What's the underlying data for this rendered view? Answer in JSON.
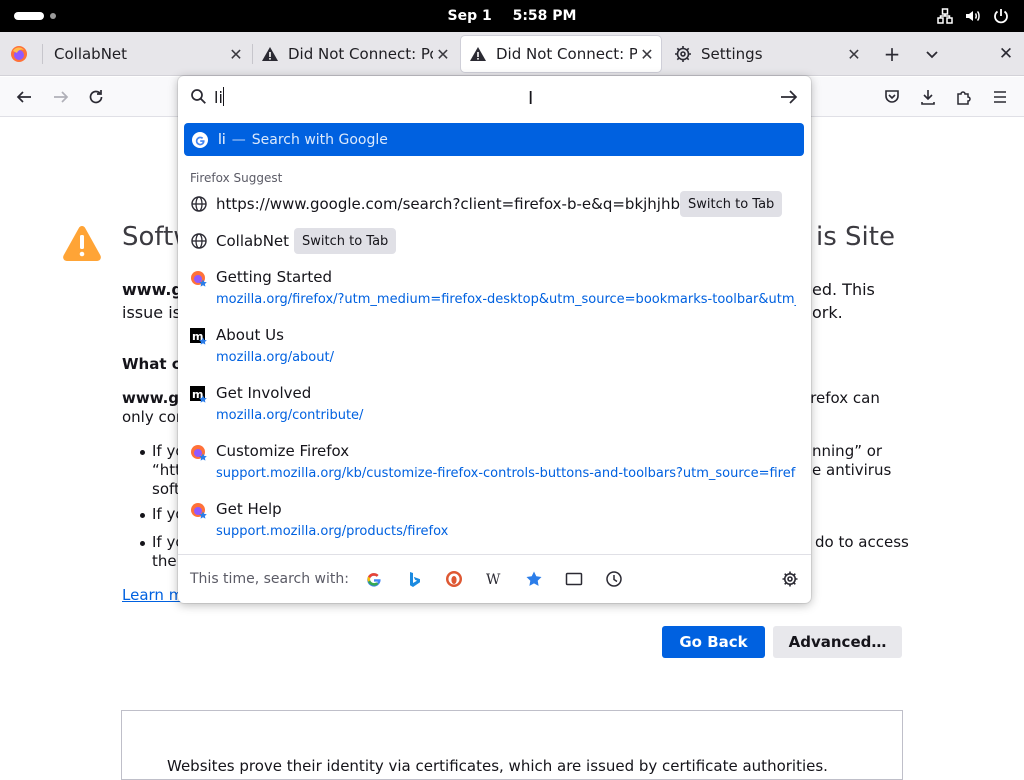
{
  "system": {
    "date": "Sep 1",
    "time": "5:58 PM"
  },
  "tabs": [
    {
      "label": "CollabNet",
      "icon": "firefox-icon",
      "selected": false
    },
    {
      "label": "Did Not Connect: Poter",
      "icon": "warning-icon",
      "selected": false
    },
    {
      "label": "Did Not Connect: Poter",
      "icon": "warning-icon",
      "selected": true
    },
    {
      "label": "Settings",
      "icon": "gear-icon",
      "selected": false
    }
  ],
  "urlbar": {
    "value": "li",
    "selected_suggestion": {
      "text": "li",
      "separator": "—",
      "action": "Search with Google"
    },
    "group_label": "Firefox Suggest",
    "switch_tab_label": "Switch to Tab",
    "results": [
      {
        "title": "https://www.google.com/search?client=firefox-b-e&q=bkjhjhbknkj",
        "icon": "globe-icon",
        "switch_to_tab": true
      },
      {
        "title": "CollabNet",
        "icon": "globe-icon",
        "switch_to_tab": true
      },
      {
        "title": "Getting Started",
        "url": "mozilla.org/firefox/?utm_medium=firefox-desktop&utm_source=bookmarks-toolbar&utm_campaign",
        "icon": "firefox-bookmark-icon"
      },
      {
        "title": "About Us",
        "url": "mozilla.org/about/",
        "icon": "mozilla-bookmark-icon"
      },
      {
        "title": "Get Involved",
        "url": "mozilla.org/contribute/",
        "icon": "mozilla-bookmark-icon"
      },
      {
        "title": "Customize Firefox",
        "url": "support.mozilla.org/kb/customize-firefox-controls-buttons-and-toolbars?utm_source=firefox-brow",
        "icon": "firefox-bookmark-icon"
      },
      {
        "title": "Get Help",
        "url": "support.mozilla.org/products/firefox",
        "icon": "firefox-bookmark-icon"
      }
    ],
    "footer_label": "This time, search with:",
    "engines": [
      "google-icon",
      "bing-icon",
      "duckduckgo-icon",
      "wikipedia-icon",
      "bookmarks-icon",
      "tabs-icon",
      "history-icon"
    ]
  },
  "page": {
    "title_left": "Softw",
    "title_right": "is Site",
    "line1_left": "www.g",
    "line1_right": "ed. This",
    "line2_left": "issue is",
    "line2_right": "ork.",
    "what_heading": "What ca",
    "para2_l1_left": "www.go",
    "para2_l1_right": "irefox can",
    "para2_l2_left": "only con",
    "b1_l1_left": "If yo",
    "b1_l1_right": "nning” or",
    "b1_l2_left": "“htt",
    "b1_l2_right": "e antivirus",
    "b1_l3_left": "soft",
    "b2_left": "If yo",
    "b3_l1_left": "If yo",
    "b3_l1_right": "do to access",
    "b3_l2_left": "the",
    "learn_more": "Learn m",
    "go_back": "Go Back",
    "advanced": "Advanced…",
    "cert_text": "Websites prove their identity via certificates, which are issued by certificate authorities."
  },
  "colors": {
    "accent": "#0061e0",
    "warning": "#ffa436"
  }
}
